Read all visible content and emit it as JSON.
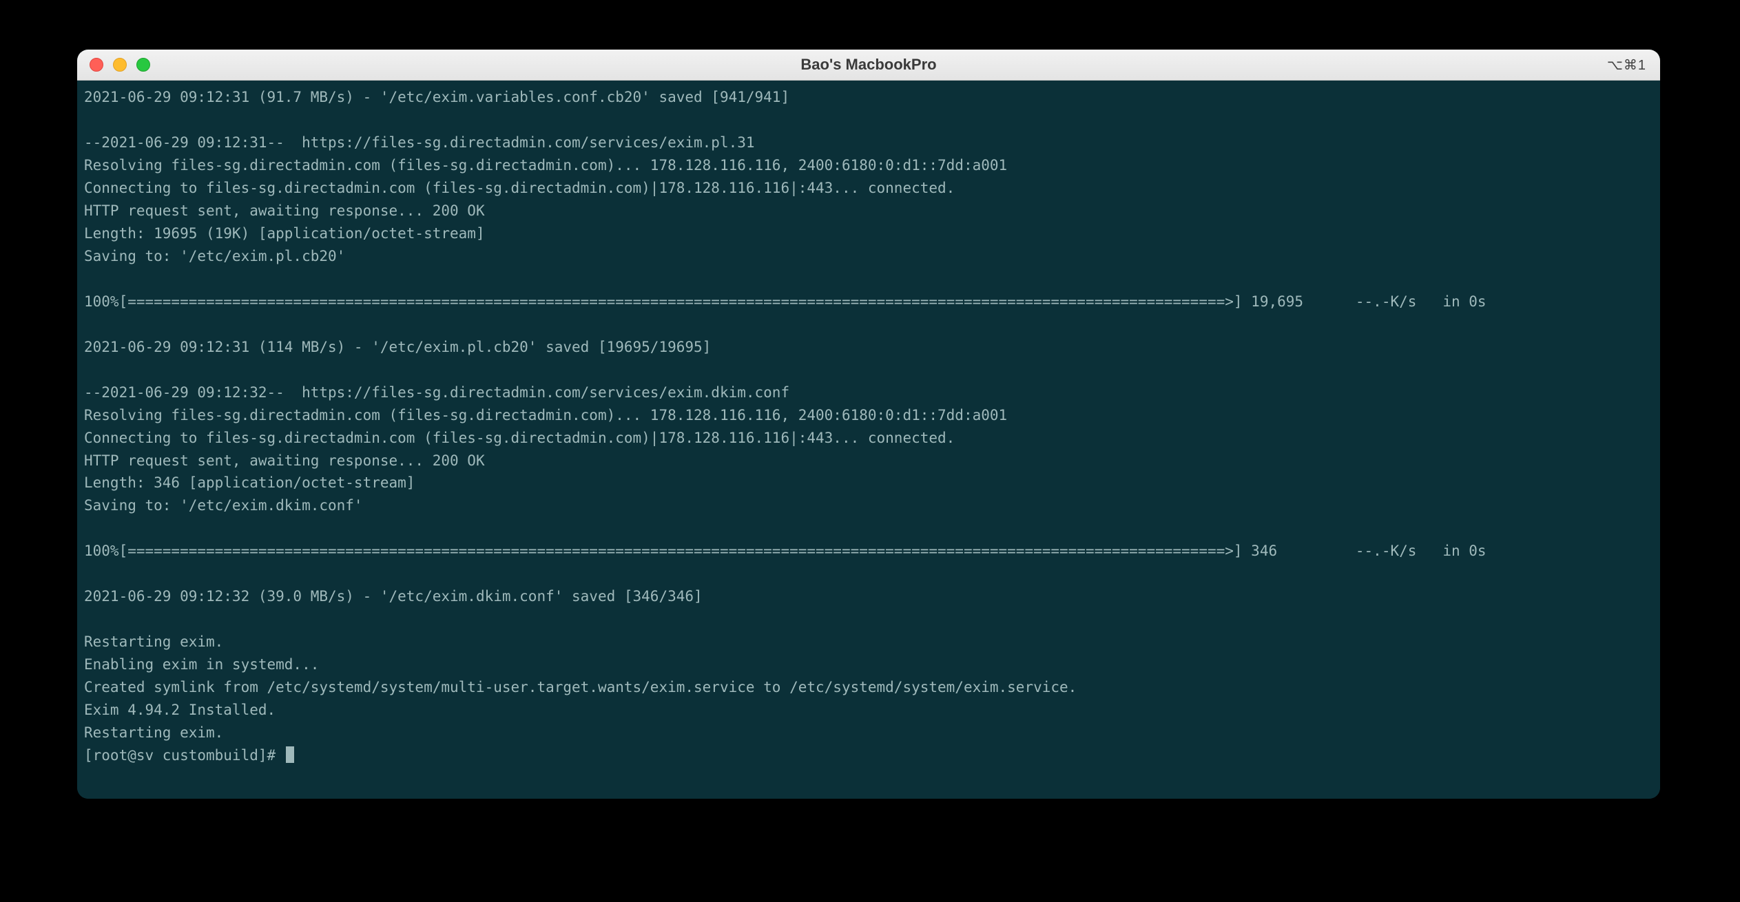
{
  "titlebar": {
    "title": "Bao's MacbookPro",
    "shortcut": "⌥⌘1"
  },
  "terminal": {
    "prompt": "[root@sv custombuild]# ",
    "lines": [
      "2021-06-29 09:12:31 (91.7 MB/s) - '/etc/exim.variables.conf.cb20' saved [941/941]",
      "",
      "--2021-06-29 09:12:31--  https://files-sg.directadmin.com/services/exim.pl.31",
      "Resolving files-sg.directadmin.com (files-sg.directadmin.com)... 178.128.116.116, 2400:6180:0:d1::7dd:a001",
      "Connecting to files-sg.directadmin.com (files-sg.directadmin.com)|178.128.116.116|:443... connected.",
      "HTTP request sent, awaiting response... 200 OK",
      "Length: 19695 (19K) [application/octet-stream]",
      "Saving to: '/etc/exim.pl.cb20'",
      "",
      "100%[==============================================================================================================================>] 19,695      --.-K/s   in 0s",
      "",
      "2021-06-29 09:12:31 (114 MB/s) - '/etc/exim.pl.cb20' saved [19695/19695]",
      "",
      "--2021-06-29 09:12:32--  https://files-sg.directadmin.com/services/exim.dkim.conf",
      "Resolving files-sg.directadmin.com (files-sg.directadmin.com)... 178.128.116.116, 2400:6180:0:d1::7dd:a001",
      "Connecting to files-sg.directadmin.com (files-sg.directadmin.com)|178.128.116.116|:443... connected.",
      "HTTP request sent, awaiting response... 200 OK",
      "Length: 346 [application/octet-stream]",
      "Saving to: '/etc/exim.dkim.conf'",
      "",
      "100%[==============================================================================================================================>] 346         --.-K/s   in 0s",
      "",
      "2021-06-29 09:12:32 (39.0 MB/s) - '/etc/exim.dkim.conf' saved [346/346]",
      "",
      "Restarting exim.",
      "Enabling exim in systemd...",
      "Created symlink from /etc/systemd/system/multi-user.target.wants/exim.service to /etc/systemd/system/exim.service.",
      "Exim 4.94.2 Installed.",
      "Restarting exim."
    ]
  }
}
